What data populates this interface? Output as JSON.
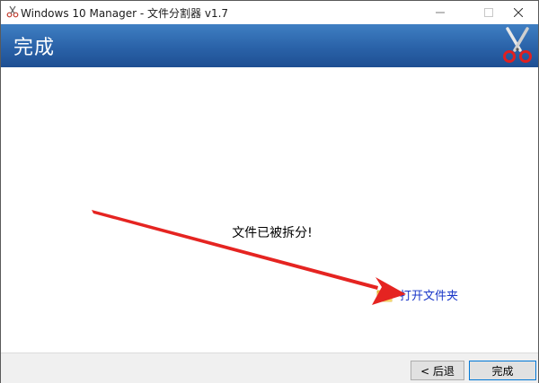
{
  "window": {
    "title": "Windows 10 Manager - 文件分割器 v1.7"
  },
  "header": {
    "title": "完成",
    "icon": "scissors-icon"
  },
  "content": {
    "message": "文件已被拆分!",
    "open_folder_label": "打开文件夹",
    "folder_icon": "folder-icon"
  },
  "footer": {
    "back_label": "< 后退",
    "finish_label": "完成"
  },
  "colors": {
    "header_blue": "#2a62a8",
    "link_blue": "#1a37c8",
    "arrow_red": "#e52421"
  }
}
